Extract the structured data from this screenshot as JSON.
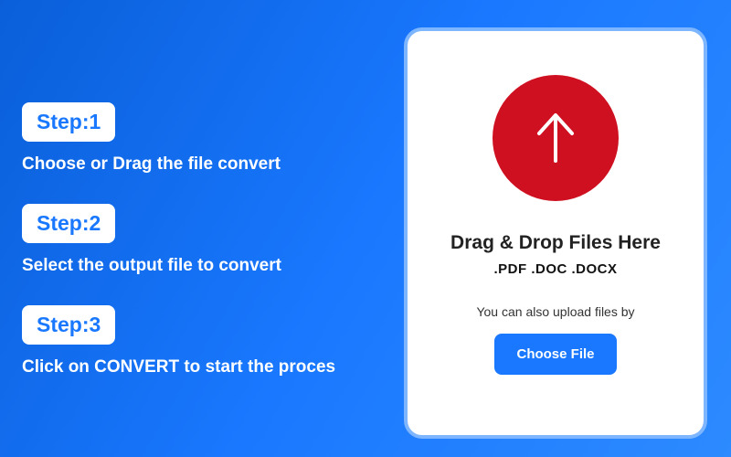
{
  "steps": [
    {
      "badge": "Step:1",
      "desc": "Choose or Drag the file convert"
    },
    {
      "badge": "Step:2",
      "desc": "Select the output file to convert"
    },
    {
      "badge": "Step:3",
      "desc": "Click on CONVERT to start the proces"
    }
  ],
  "card": {
    "title": "Drag & Drop Files Here",
    "formats": ".PDF   .DOC   .DOCX",
    "also": "You can also upload files by",
    "button": "Choose File"
  }
}
